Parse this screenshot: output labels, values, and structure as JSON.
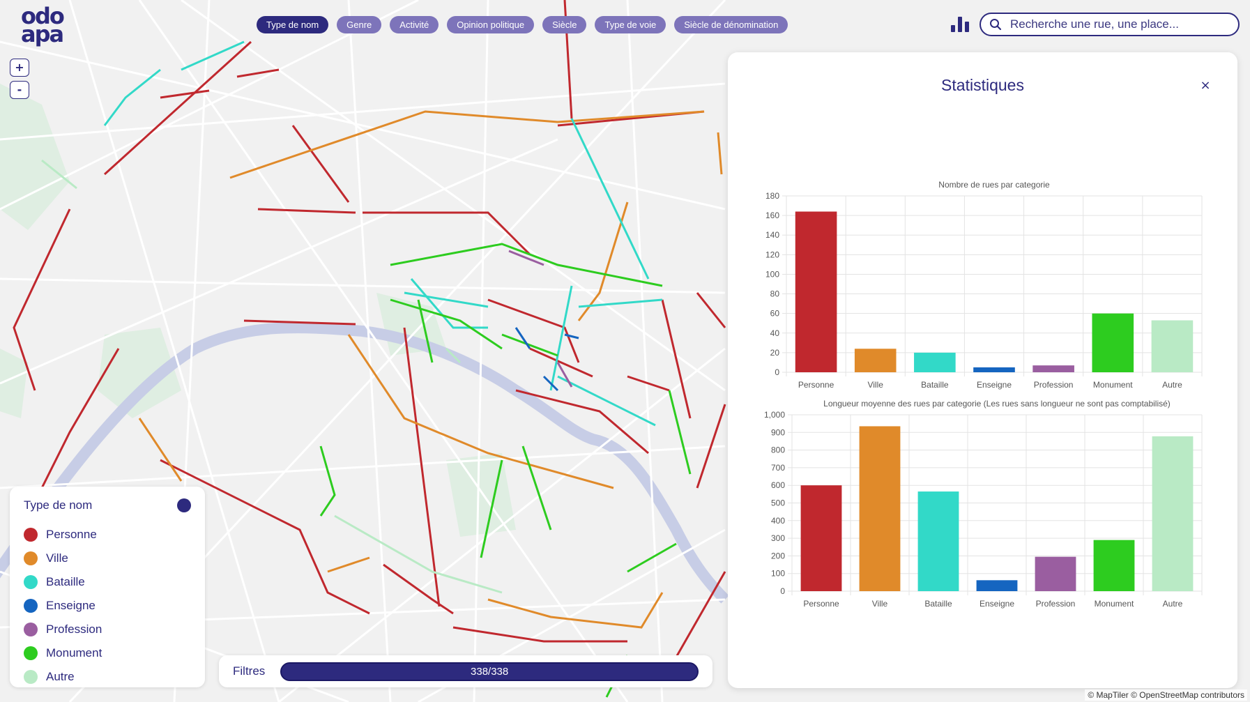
{
  "app": {
    "logo_line1": "odo",
    "logo_line2": "apa"
  },
  "zoom": {
    "in_label": "+",
    "out_label": "-"
  },
  "filters": [
    {
      "label": "Type de nom",
      "active": true
    },
    {
      "label": "Genre",
      "active": false
    },
    {
      "label": "Activité",
      "active": false
    },
    {
      "label": "Opinion politique",
      "active": false
    },
    {
      "label": "Siècle",
      "active": false
    },
    {
      "label": "Type de voie",
      "active": false
    },
    {
      "label": "Siècle de dénomination",
      "active": false
    }
  ],
  "search": {
    "placeholder": "Recherche une rue, une place..."
  },
  "legend": {
    "title": "Type de nom",
    "items": [
      {
        "label": "Personne",
        "color": "#c0282e"
      },
      {
        "label": "Ville",
        "color": "#e08a2a"
      },
      {
        "label": "Bataille",
        "color": "#32d9c8"
      },
      {
        "label": "Enseigne",
        "color": "#1565c0"
      },
      {
        "label": "Profession",
        "color": "#9a5ea0"
      },
      {
        "label": "Monument",
        "color": "#2dcc1f"
      },
      {
        "label": "Autre",
        "color": "#b9eac5"
      }
    ]
  },
  "filterbar": {
    "label": "Filtres",
    "count_text": "338/338",
    "filtered": 338,
    "total": 338
  },
  "stats_panel": {
    "title": "Statistiques",
    "close_label": "×"
  },
  "attribution": "© MapTiler © OpenStreetMap contributors",
  "chart_data": [
    {
      "type": "bar",
      "title": "Nombre de rues par categorie",
      "categories": [
        "Personne",
        "Ville",
        "Bataille",
        "Enseigne",
        "Profession",
        "Monument",
        "Autre"
      ],
      "values": [
        164,
        24,
        20,
        5,
        7,
        60,
        53
      ],
      "colors": [
        "#c0282e",
        "#e08a2a",
        "#32d9c8",
        "#1565c0",
        "#9a5ea0",
        "#2dcc1f",
        "#b9eac5"
      ],
      "ylim": [
        0,
        180
      ],
      "yticks": [
        0,
        20,
        40,
        60,
        80,
        100,
        120,
        140,
        160,
        180
      ],
      "ytick_labels": [
        "0",
        "20",
        "40",
        "60",
        "80",
        "100",
        "120",
        "140",
        "160",
        "180"
      ],
      "grid": true
    },
    {
      "type": "bar",
      "title": "Longueur moyenne des rues par categorie (Les rues sans longueur ne sont pas comptabilisé)",
      "categories": [
        "Personne",
        "Ville",
        "Bataille",
        "Enseigne",
        "Profession",
        "Monument",
        "Autre"
      ],
      "values": [
        600,
        935,
        565,
        62,
        195,
        290,
        878
      ],
      "colors": [
        "#c0282e",
        "#e08a2a",
        "#32d9c8",
        "#1565c0",
        "#9a5ea0",
        "#2dcc1f",
        "#b9eac5"
      ],
      "ylim": [
        0,
        1000
      ],
      "yticks": [
        0,
        100,
        200,
        300,
        400,
        500,
        600,
        700,
        800,
        900,
        1000
      ],
      "ytick_labels": [
        "0",
        "100",
        "200",
        "300",
        "400",
        "500",
        "600",
        "700",
        "800",
        "900",
        "1,000"
      ],
      "grid": true
    }
  ]
}
